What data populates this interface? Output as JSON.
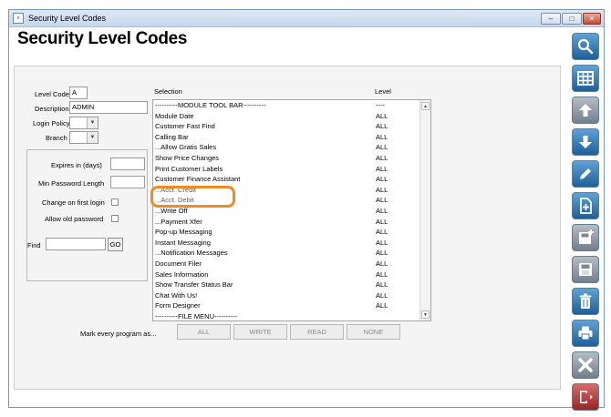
{
  "window": {
    "title_icon": "▫",
    "title": "Security Level Codes",
    "min_symbol": "‒",
    "max_symbol": "□",
    "close_symbol": "✕"
  },
  "page": {
    "title": "Security Level Codes"
  },
  "form": {
    "level_code_label": "Level Code",
    "level_code_value": "A",
    "description_label": "Description",
    "description_value": "ADMIN",
    "login_policy_label": "Login Policy",
    "login_policy_value": "",
    "branch_label": "Branch",
    "branch_value": "",
    "expires_label": "Expires in (days)",
    "expires_value": "",
    "min_password_label": "Min Password Length",
    "min_password_value": "",
    "change_first_login_label": "Change on first login",
    "allow_old_password_label": "Allow old password",
    "find_label": "Find",
    "find_value": "",
    "go_label": "GO"
  },
  "selection_list": {
    "selection_header": "Selection",
    "level_header": "Level",
    "rows": [
      {
        "selection": "----------MODULE TOOL BAR----------",
        "level": "----"
      },
      {
        "selection": "Module Date",
        "level": "ALL"
      },
      {
        "selection": "Customer Fast Find",
        "level": "ALL"
      },
      {
        "selection": "Calling Bar",
        "level": "ALL"
      },
      {
        "selection": "...Allow Gratis Sales",
        "level": "ALL"
      },
      {
        "selection": "Show Price Changes",
        "level": "ALL"
      },
      {
        "selection": "Print Customer Labels",
        "level": "ALL"
      },
      {
        "selection": "Customer Finance Assistant",
        "level": "ALL"
      },
      {
        "selection": "...Acct. Credit",
        "level": "ALL"
      },
      {
        "selection": "...Acct. Debit",
        "level": "ALL"
      },
      {
        "selection": "...Write Off",
        "level": "ALL"
      },
      {
        "selection": "...Payment Xfer",
        "level": "ALL"
      },
      {
        "selection": "Pop-up Messaging",
        "level": "ALL"
      },
      {
        "selection": "Instant Messaging",
        "level": "ALL"
      },
      {
        "selection": "...Notification Messages",
        "level": "ALL"
      },
      {
        "selection": "Document Filer",
        "level": "ALL"
      },
      {
        "selection": "Sales Information",
        "level": "ALL"
      },
      {
        "selection": "Show Transfer Status Bar",
        "level": "ALL"
      },
      {
        "selection": "Chat With Us!",
        "level": "ALL"
      },
      {
        "selection": "Form Designer",
        "level": "ALL"
      },
      {
        "selection": "----------FILE MENU----------",
        "level": ""
      }
    ]
  },
  "mark": {
    "label": "Mark every program as...",
    "all": "ALL",
    "write": "WRITE",
    "read": "READ",
    "none": "NONE"
  },
  "toolbar": {
    "icons": [
      "search-icon",
      "grid-icon",
      "up-arrow-icon",
      "down-arrow-icon",
      "edit-icon",
      "add-document-icon",
      "save-new-icon",
      "save-icon",
      "delete-icon",
      "print-icon",
      "cancel-icon",
      "exit-icon"
    ]
  },
  "colors": {
    "accent_blue": "#2f73b1",
    "highlight_orange": "#f08a24",
    "exit_red": "#b33030"
  }
}
